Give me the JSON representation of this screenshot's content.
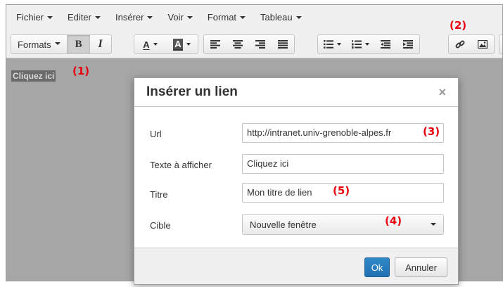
{
  "menubar": {
    "items": [
      "Fichier",
      "Editer",
      "Insérer",
      "Voir",
      "Format",
      "Tableau"
    ]
  },
  "toolbar": {
    "formats_label": "Formats",
    "buttons": [
      "bold-icon",
      "italic-icon",
      "text-color-icon",
      "background-color-icon",
      "align-left-icon",
      "align-center-icon",
      "align-right-icon",
      "align-justify-icon",
      "bullet-list-icon",
      "numbered-list-icon",
      "outdent-icon",
      "indent-icon",
      "link-icon",
      "image-icon"
    ],
    "bold_glyph": "B",
    "italic_glyph": "I",
    "text_color_glyph": "A",
    "bg_color_glyph": "A"
  },
  "editor": {
    "selected_text": "Cliquez ici"
  },
  "annotations": {
    "a1": "(1)",
    "a2": "(2)",
    "a3": "(3)",
    "a4": "(4)",
    "a5": "(5)"
  },
  "dialog": {
    "title": "Insérer un lien",
    "close_glyph": "×",
    "fields": {
      "url": {
        "label": "Url",
        "value": "http://intranet.univ-grenoble-alpes.fr"
      },
      "text": {
        "label": "Texte à afficher",
        "value": "Cliquez ici"
      },
      "title": {
        "label": "Titre",
        "value": "Mon titre de lien"
      },
      "target": {
        "label": "Cible",
        "value": "Nouvelle fenêtre"
      }
    },
    "ok_label": "Ok",
    "cancel_label": "Annuler"
  },
  "colors": {
    "primary": "#2170b2",
    "annotation": "#e8000f",
    "editor_bg": "#a6a6a6"
  }
}
